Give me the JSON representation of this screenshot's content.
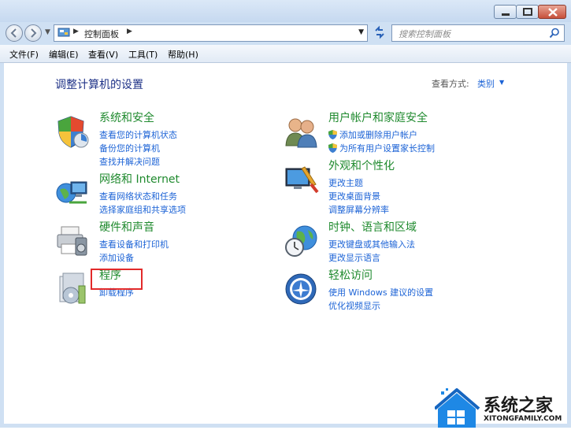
{
  "window": {
    "address": "控制面板",
    "search_placeholder": "搜索控制面板"
  },
  "menu": [
    "文件(F)",
    "编辑(E)",
    "查看(V)",
    "工具(T)",
    "帮助(H)"
  ],
  "page_title": "调整计算机的设置",
  "view": {
    "label": "查看方式:",
    "value": "类别"
  },
  "categories": [
    {
      "title": "系统和安全",
      "links": [
        "查看您的计算机状态",
        "备份您的计算机",
        "查找并解决问题"
      ]
    },
    {
      "title": "网络和 Internet",
      "links": [
        "查看网络状态和任务",
        "选择家庭组和共享选项"
      ]
    },
    {
      "title": "硬件和声音",
      "links": [
        "查看设备和打印机",
        "添加设备"
      ]
    },
    {
      "title": "程序",
      "links": [
        "卸载程序"
      ]
    },
    {
      "title": "用户帐户和家庭安全",
      "links": [
        "添加或删除用户帐户",
        "为所有用户设置家长控制"
      ]
    },
    {
      "title": "外观和个性化",
      "links": [
        "更改主题",
        "更改桌面背景",
        "调整屏幕分辨率"
      ]
    },
    {
      "title": "时钟、语言和区域",
      "links": [
        "更改键盘或其他输入法",
        "更改显示语言"
      ]
    },
    {
      "title": "轻松访问",
      "links": [
        "使用 Windows 建议的设置",
        "优化视频显示"
      ]
    }
  ],
  "watermark": {
    "text": "系统之家",
    "sub": "XITONGFAMILY.COM"
  },
  "colors": {
    "category_title": "#1f8a2e",
    "link": "#1c63d6",
    "highlight": "#e22a2a"
  }
}
